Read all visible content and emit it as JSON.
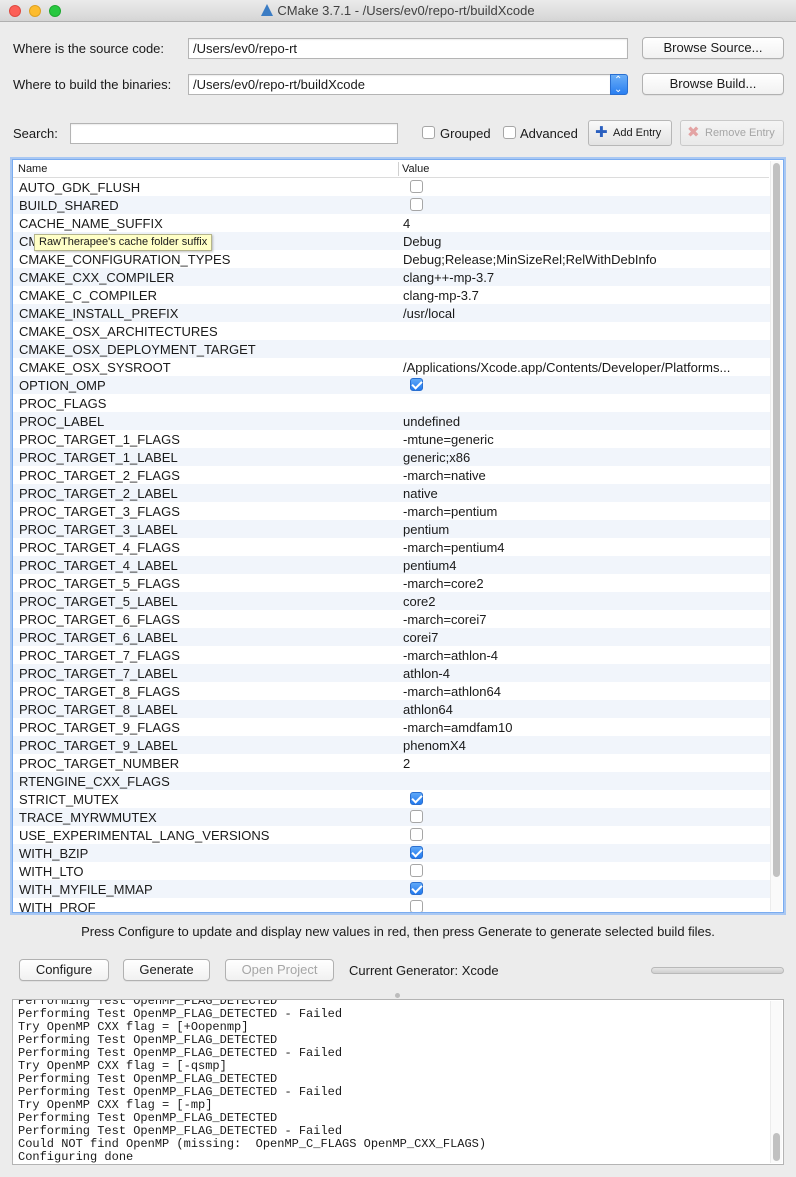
{
  "window": {
    "title": "CMake 3.7.1 - /Users/ev0/repo-rt/buildXcode"
  },
  "source": {
    "label": "Where is the source code:",
    "value": "/Users/ev0/repo-rt",
    "browse_label": "Browse Source..."
  },
  "build": {
    "label": "Where to build the binaries:",
    "value": "/Users/ev0/repo-rt/buildXcode",
    "browse_label": "Browse Build..."
  },
  "search": {
    "label": "Search:",
    "value": "",
    "grouped_label": "Grouped",
    "grouped_checked": false,
    "advanced_label": "Advanced",
    "advanced_checked": false,
    "add_entry_label": "Add Entry",
    "remove_entry_label": "Remove Entry"
  },
  "table": {
    "headers": {
      "name": "Name",
      "value": "Value"
    },
    "rows": [
      {
        "name": "AUTO_GDK_FLUSH",
        "type": "bool",
        "checked": false
      },
      {
        "name": "BUILD_SHARED",
        "type": "bool",
        "checked": false
      },
      {
        "name": "CACHE_NAME_SUFFIX",
        "type": "text",
        "value": "4"
      },
      {
        "name": "CMAKE_BUILD_TYPE",
        "type": "text",
        "value": "Debug"
      },
      {
        "name": "CMAKE_CONFIGURATION_TYPES",
        "type": "text",
        "value": "Debug;Release;MinSizeRel;RelWithDebInfo"
      },
      {
        "name": "CMAKE_CXX_COMPILER",
        "type": "text",
        "value": "clang++-mp-3.7"
      },
      {
        "name": "CMAKE_C_COMPILER",
        "type": "text",
        "value": "clang-mp-3.7"
      },
      {
        "name": "CMAKE_INSTALL_PREFIX",
        "type": "text",
        "value": "/usr/local"
      },
      {
        "name": "CMAKE_OSX_ARCHITECTURES",
        "type": "text",
        "value": ""
      },
      {
        "name": "CMAKE_OSX_DEPLOYMENT_TARGET",
        "type": "text",
        "value": ""
      },
      {
        "name": "CMAKE_OSX_SYSROOT",
        "type": "text",
        "value": "/Applications/Xcode.app/Contents/Developer/Platforms..."
      },
      {
        "name": "OPTION_OMP",
        "type": "bool",
        "checked": true
      },
      {
        "name": "PROC_FLAGS",
        "type": "text",
        "value": ""
      },
      {
        "name": "PROC_LABEL",
        "type": "text",
        "value": "undefined"
      },
      {
        "name": "PROC_TARGET_1_FLAGS",
        "type": "text",
        "value": "-mtune=generic"
      },
      {
        "name": "PROC_TARGET_1_LABEL",
        "type": "text",
        "value": "generic;x86"
      },
      {
        "name": "PROC_TARGET_2_FLAGS",
        "type": "text",
        "value": "-march=native"
      },
      {
        "name": "PROC_TARGET_2_LABEL",
        "type": "text",
        "value": "native"
      },
      {
        "name": "PROC_TARGET_3_FLAGS",
        "type": "text",
        "value": "-march=pentium"
      },
      {
        "name": "PROC_TARGET_3_LABEL",
        "type": "text",
        "value": "pentium"
      },
      {
        "name": "PROC_TARGET_4_FLAGS",
        "type": "text",
        "value": "-march=pentium4"
      },
      {
        "name": "PROC_TARGET_4_LABEL",
        "type": "text",
        "value": "pentium4"
      },
      {
        "name": "PROC_TARGET_5_FLAGS",
        "type": "text",
        "value": "-march=core2"
      },
      {
        "name": "PROC_TARGET_5_LABEL",
        "type": "text",
        "value": "core2"
      },
      {
        "name": "PROC_TARGET_6_FLAGS",
        "type": "text",
        "value": "-march=corei7"
      },
      {
        "name": "PROC_TARGET_6_LABEL",
        "type": "text",
        "value": "corei7"
      },
      {
        "name": "PROC_TARGET_7_FLAGS",
        "type": "text",
        "value": "-march=athlon-4"
      },
      {
        "name": "PROC_TARGET_7_LABEL",
        "type": "text",
        "value": "athlon-4"
      },
      {
        "name": "PROC_TARGET_8_FLAGS",
        "type": "text",
        "value": "-march=athlon64"
      },
      {
        "name": "PROC_TARGET_8_LABEL",
        "type": "text",
        "value": "athlon64"
      },
      {
        "name": "PROC_TARGET_9_FLAGS",
        "type": "text",
        "value": "-march=amdfam10"
      },
      {
        "name": "PROC_TARGET_9_LABEL",
        "type": "text",
        "value": "phenomX4"
      },
      {
        "name": "PROC_TARGET_NUMBER",
        "type": "text",
        "value": "2"
      },
      {
        "name": "RTENGINE_CXX_FLAGS",
        "type": "text",
        "value": ""
      },
      {
        "name": "STRICT_MUTEX",
        "type": "bool",
        "checked": true
      },
      {
        "name": "TRACE_MYRWMUTEX",
        "type": "bool",
        "checked": false
      },
      {
        "name": "USE_EXPERIMENTAL_LANG_VERSIONS",
        "type": "bool",
        "checked": false
      },
      {
        "name": "WITH_BZIP",
        "type": "bool",
        "checked": true
      },
      {
        "name": "WITH_LTO",
        "type": "bool",
        "checked": false
      },
      {
        "name": "WITH_MYFILE_MMAP",
        "type": "bool",
        "checked": true
      },
      {
        "name": "WITH_PROF",
        "type": "bool",
        "checked": false
      }
    ],
    "tooltip": "RawTherapee's cache folder suffix"
  },
  "hint": "Press Configure to update and display new values in red, then press Generate to generate selected build files.",
  "actions": {
    "configure_label": "Configure",
    "generate_label": "Generate",
    "open_project_label": "Open Project",
    "generator_text": "Current Generator: Xcode"
  },
  "log": {
    "lines": [
      "Performing Test OpenMP_FLAG_DETECTED",
      "Performing Test OpenMP_FLAG_DETECTED - Failed",
      "Try OpenMP CXX flag = [+Oopenmp]",
      "Performing Test OpenMP_FLAG_DETECTED",
      "Performing Test OpenMP_FLAG_DETECTED - Failed",
      "Try OpenMP CXX flag = [-qsmp]",
      "Performing Test OpenMP_FLAG_DETECTED",
      "Performing Test OpenMP_FLAG_DETECTED - Failed",
      "Try OpenMP CXX flag = [-mp]",
      "Performing Test OpenMP_FLAG_DETECTED",
      "Performing Test OpenMP_FLAG_DETECTED - Failed",
      "Could NOT find OpenMP (missing:  OpenMP_C_FLAGS OpenMP_CXX_FLAGS)",
      "Configuring done"
    ]
  },
  "icons": {
    "add": "plus-icon",
    "remove": "cross-icon",
    "combo": "chevron-updown-icon"
  },
  "colors": {
    "accent": "#2a7ff1",
    "selection_border": "#7aacf0",
    "tooltip_bg": "#ffffc7",
    "row_alt": "#f1f5fb"
  }
}
